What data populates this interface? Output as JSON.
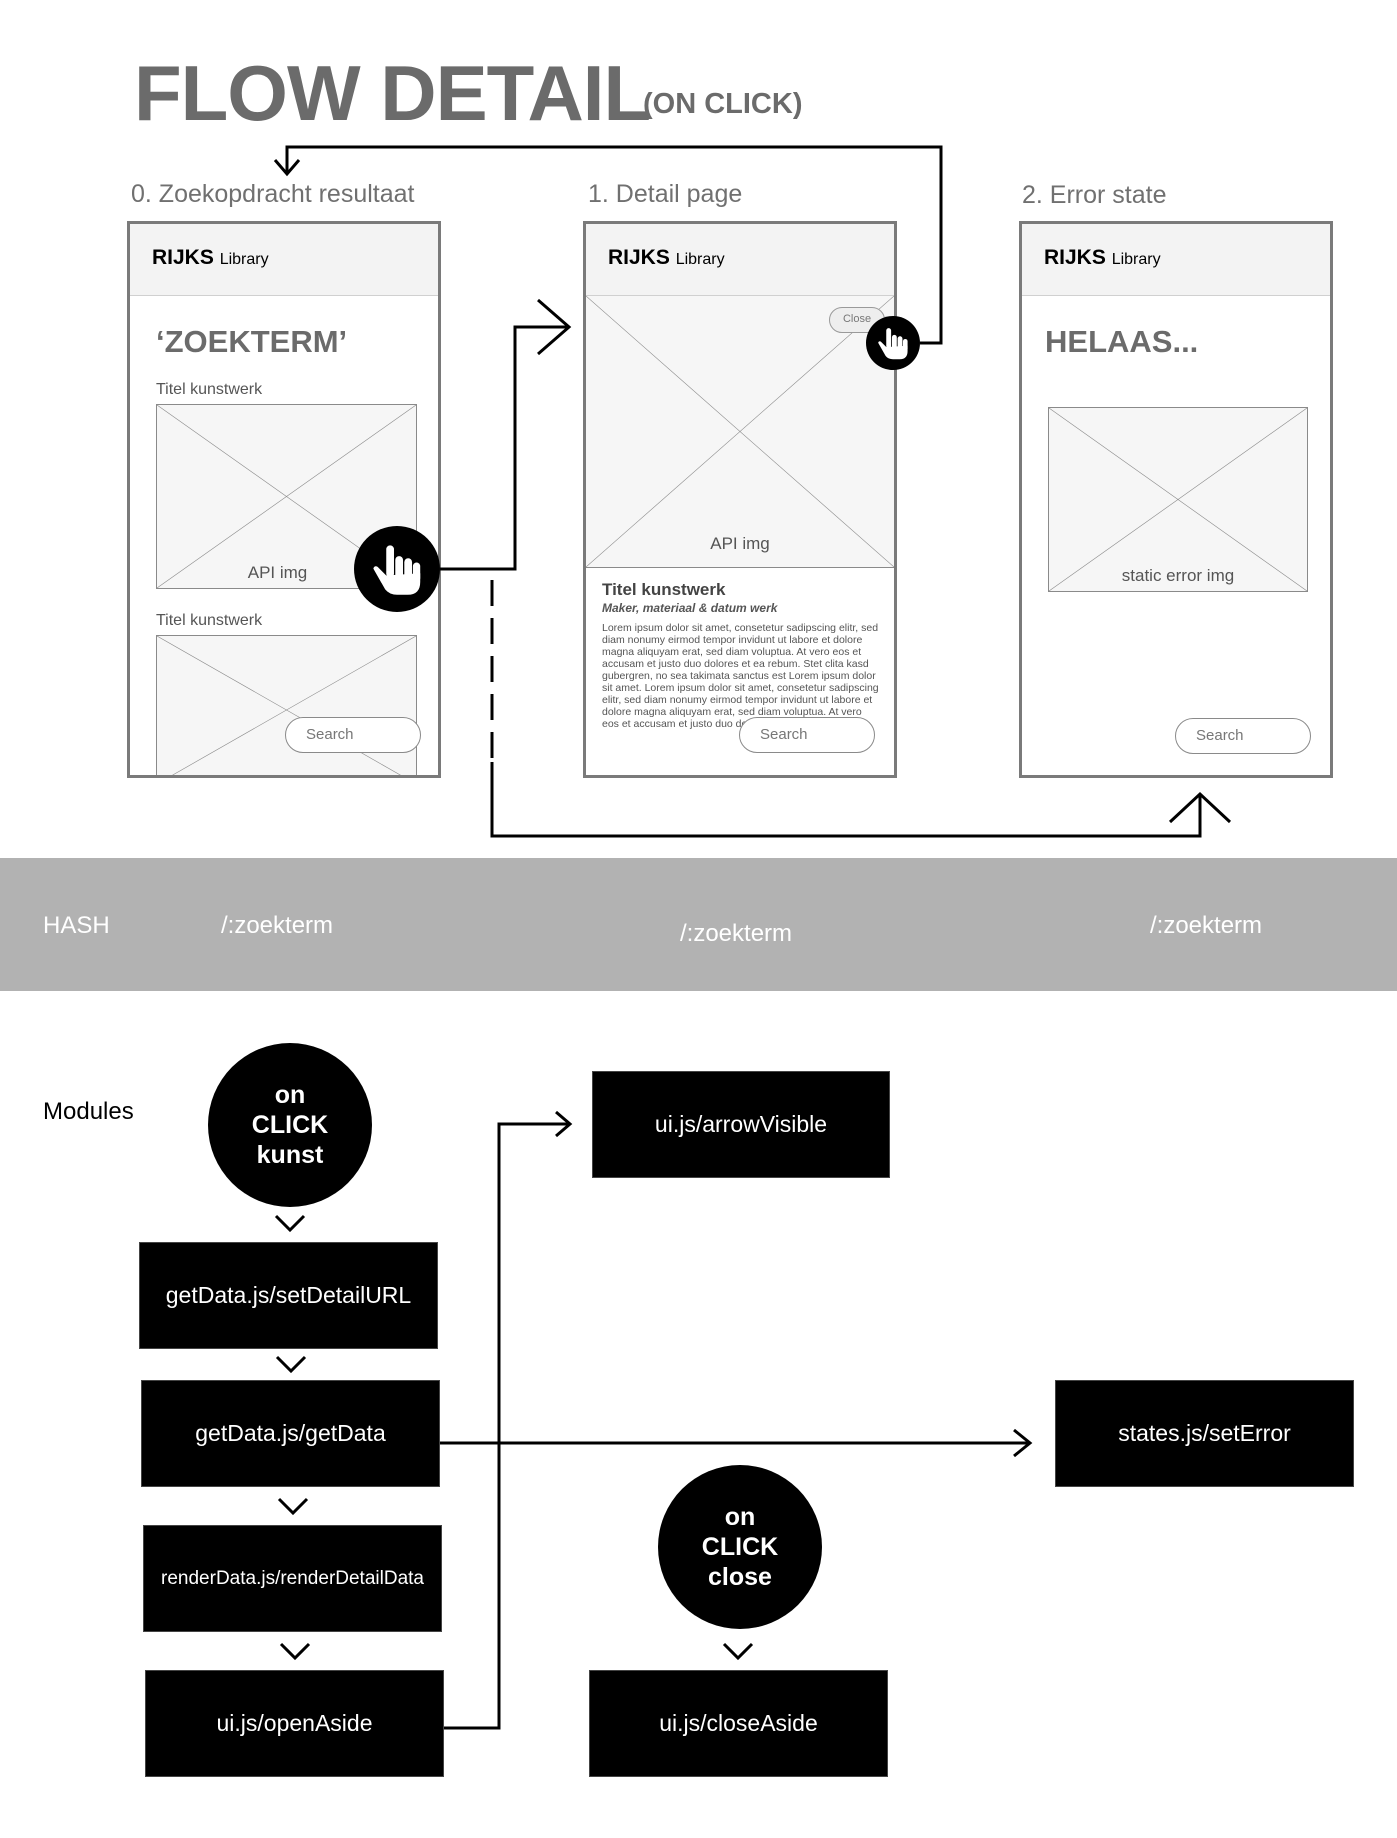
{
  "title": "FLOW DETAIL",
  "subtitle": "(ON CLICK)",
  "screens": [
    {
      "label": "0. Zoekopdracht resultaat",
      "brand": "RIJKS",
      "brand_sub": "Library",
      "heading": "‘ZOEKTERM’",
      "items": [
        {
          "title": "Titel kunstwerk",
          "image_caption": "API img"
        },
        {
          "title": "Titel kunstwerk",
          "image_caption": ""
        }
      ],
      "search_placeholder": "Search"
    },
    {
      "label": "1. Detail page",
      "brand": "RIJKS",
      "brand_sub": "Library",
      "close_label": "Close",
      "image_caption": "API img",
      "detail_title": "Titel kunstwerk",
      "detail_meta": "Maker, materiaal & datum werk",
      "detail_body": "Lorem ipsum dolor sit amet, consetetur sadipscing elitr, sed diam nonumy eirmod tempor invidunt ut labore et dolore magna aliquyam erat, sed diam voluptua. At vero eos et accusam et justo duo dolores et ea rebum. Stet clita kasd gubergren, no sea takimata sanctus est Lorem ipsum dolor sit amet. Lorem ipsum dolor sit amet, consetetur sadipscing elitr, sed diam nonumy eirmod tempor invidunt ut labore et dolore magna aliquyam erat, sed diam voluptua. At vero eos et accusam et justo duo dolores",
      "search_placeholder": "Search"
    },
    {
      "label": "2. Error state",
      "brand": "RIJKS",
      "brand_sub": "Library",
      "heading": "HELAAS...",
      "image_caption": "static error img",
      "search_placeholder": "Search"
    }
  ],
  "hash_band": {
    "label": "HASH",
    "routes": [
      "/:zoekterm",
      "/:zoekterm",
      "/:zoekterm"
    ]
  },
  "modules_section": {
    "label": "Modules",
    "trigger_kunst": [
      "on",
      "CLICK",
      "kunst"
    ],
    "trigger_close": [
      "on",
      "CLICK",
      "close"
    ],
    "modules": {
      "set_detail_url": "getData.js/setDetailURL",
      "get_data": "getData.js/getData",
      "render_detail": "renderData.js/renderDetailData",
      "open_aside": "ui.js/openAside",
      "arrow_visible": "ui.js/arrowVisible",
      "set_error": "states.js/setError",
      "close_aside": "ui.js/closeAside"
    }
  },
  "colors": {
    "title_gray": "#6b6b6b",
    "band_gray": "#b2b2b2",
    "module_black": "#000000"
  }
}
